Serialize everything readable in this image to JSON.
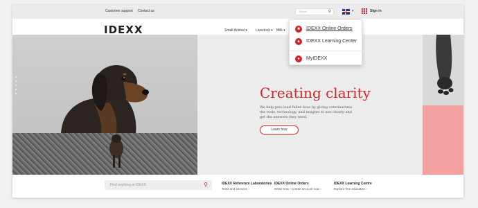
{
  "utility_bar": {
    "customer_support": "Customer support",
    "contact_us": "Contact us",
    "search_placeholder": "Search",
    "sign_in": "Sign in"
  },
  "header": {
    "logo": "IDEXX",
    "nav": [
      "Small Animal ▾",
      "Livestock ▾",
      "Milk ▾"
    ]
  },
  "dropdown": {
    "items": [
      {
        "label": "IDEXX Online Orders",
        "icon": "cart-icon"
      },
      {
        "label": "IDEXX Learning Center",
        "icon": "learning-icon"
      },
      {
        "label": "MyIDEXX",
        "icon": "user-icon"
      }
    ]
  },
  "hero": {
    "headline": "Creating clarity",
    "subtext": "We help pets lead fuller lives by giving veterinarians the tools, technology, and insights to see clearly and get the answers they need.",
    "button": "Learn how"
  },
  "bottom_bar": {
    "search_placeholder": "Find anything at IDEXX",
    "links": [
      {
        "title": "IDEXX Reference Laboratories",
        "sub": "Tests and services ›"
      },
      {
        "title": "IDEXX Online Orders",
        "sub": "Order now ›   Create account now ›"
      },
      {
        "title": "IDEXX Learning Centre",
        "sub": "Explore free education ›"
      }
    ]
  },
  "colors": {
    "accent": "#d0232a",
    "pink_panel": "#f4a1a1"
  }
}
